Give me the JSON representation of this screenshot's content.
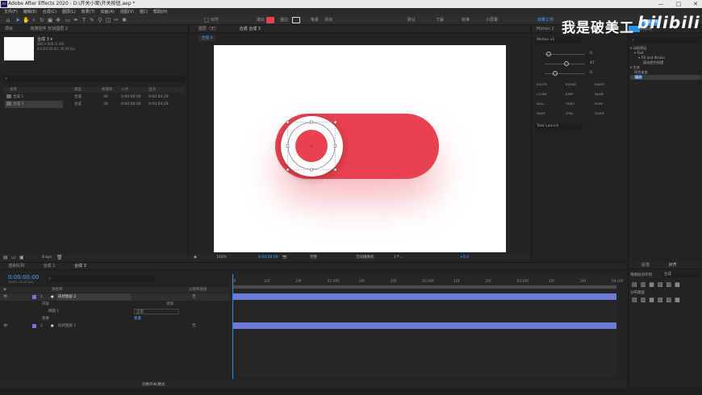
{
  "window": {
    "title": "Adobe After Effects 2020 - D:\\开关小案\\开关按钮.aep *",
    "app_icon": "Ae",
    "controls": [
      "—",
      "□",
      "✕"
    ]
  },
  "menu": [
    "文件(F)",
    "编辑(E)",
    "合成(C)",
    "图层(L)",
    "效果(T)",
    "动画(A)",
    "视图(V)",
    "窗口",
    "帮助(H)"
  ],
  "toolbar": {
    "snap_label": "对齐",
    "fill_label": "填充",
    "stroke_label": "描边",
    "stroke_value": "像素",
    "add_label": "添加",
    "workspaces": [
      "默认",
      "了解",
      "标准",
      "小屏幕"
    ],
    "active_workspace": "效果工作",
    "fill_color": "#e8414f",
    "accent": "#2d8ceb"
  },
  "project_panel": {
    "tab": "项目",
    "tab2": "效果控件 形状图层 2",
    "comp_name": "合成 3 ▾",
    "comp_info1": "800 x 600 (1.00)",
    "comp_info2": "Δ 0:00:05:00, 30.00 fps",
    "columns": [
      "名称",
      "类型",
      "帧速率",
      "入点",
      "出点"
    ],
    "items": [
      {
        "name": "合成 1",
        "type": "合成",
        "fps": "30",
        "in": "0:00:00:00",
        "out": "0:00:04:29"
      },
      {
        "name": "合成 3",
        "type": "合成",
        "fps": "30",
        "in": "0:00:00:00",
        "out": "0:00:04:29"
      }
    ],
    "bpc": "8 bpc"
  },
  "viewer": {
    "tab_layer": "图层（无）",
    "tab_comp": "合成 合成 3",
    "breadcrumb": "合成 3",
    "zoom": "100%",
    "time": "0:00:00:00",
    "quality": "完整",
    "camera": "活动摄像机",
    "views": "1个...",
    "offset": "+0.0",
    "toggle_color": "#e8414f",
    "knob_color": "#e8414f"
  },
  "right_panel": {
    "tab_motion": "Motion 2",
    "tab_effects": "效果和预设",
    "motion_version": "Motion v2",
    "search_placeholder": "",
    "slider_values": [
      "0",
      "47",
      "0"
    ],
    "motion_buttons": [
      "EXCITE",
      "BLEND",
      "BURST",
      "CLONE",
      "JUMP",
      "NAME",
      "NULL",
      "ORBIT",
      "ROPE",
      "WARP",
      "SPIN",
      "STARE"
    ],
    "task_launch": "Task Launch",
    "tree": [
      {
        "label": "动画预设",
        "level": 0
      },
      {
        "label": "Text",
        "level": 1
      },
      {
        "label": "Fill and Stroke",
        "level": 2
      },
      {
        "label": "填充颜色摇摆",
        "level": 3
      },
      {
        "label": "生成",
        "level": 0
      },
      {
        "label": "四色渐变",
        "level": 1
      },
      {
        "label": "填充",
        "level": 1
      }
    ],
    "sign_in": "登陆上线"
  },
  "align_panel": {
    "tab_para": "段落",
    "tab_align": "对齐",
    "align_to_label": "将图层对齐到",
    "align_to_value": "合成",
    "distribute_label": "分布图层"
  },
  "timeline": {
    "tabs": [
      "渲染队列",
      "合成 1",
      "合成 3"
    ],
    "current_time": "0:00:00:00",
    "fps_note": "00000 (30.00 fps)",
    "col_source": "源名称",
    "col_parent": "父级和链接",
    "parent_none": "无",
    "layers": [
      {
        "num": "1",
        "name": "形状图层 2",
        "color": "#6b7bd6"
      },
      {
        "num": "2",
        "name": "形状图层 1",
        "color": "#6b7bd6"
      }
    ],
    "sub_content": "内容",
    "sub_add": "添加",
    "sub_ellipse": "椭圆 1",
    "sub_transform": "变换",
    "blend_mode": "正常",
    "reset": "重置",
    "ruler": [
      "0f",
      "10f",
      "20f",
      "01:00f",
      "10f",
      "20f",
      "02:00f",
      "10f",
      "20f",
      "03:00f",
      "10f",
      "20f",
      "04:00f"
    ],
    "footer": "切换开关/模式"
  },
  "overlay": {
    "caption": "我是破美工",
    "brand": "bilibili"
  }
}
